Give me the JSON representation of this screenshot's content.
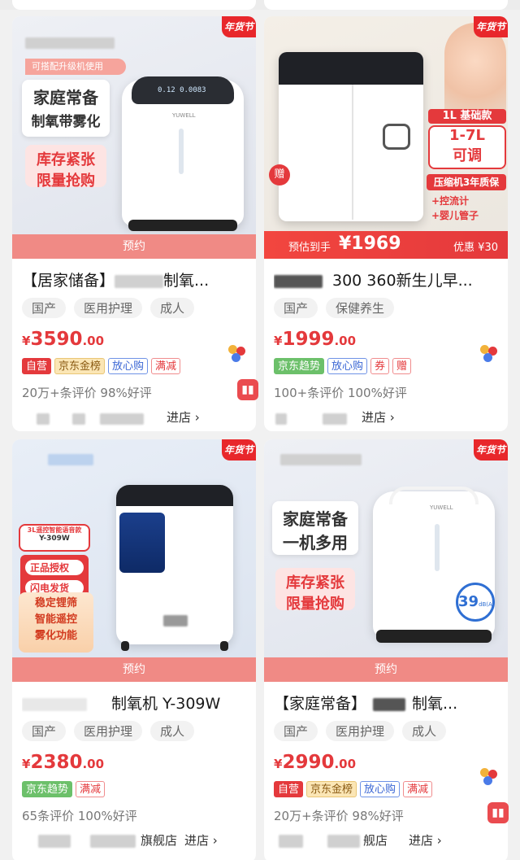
{
  "colors": {
    "accent_red": "#e4393c",
    "preorder_pink": "#f08a85",
    "tag_bg": "#f2f2f2"
  },
  "products": [
    {
      "corner_badge": "年货节",
      "image_text": {
        "top_banner": "可搭配升级机使用",
        "headline_1": "家庭常备",
        "headline_2": "制氧带雾化",
        "promo_1": "库存紧张",
        "promo_2": "限量抢购",
        "display": "0.12 0.0083",
        "brand_logo": "YUWELL"
      },
      "preorder": "预约",
      "title_prefix": "【居家储备】",
      "title_suffix": "制氧...",
      "tags": [
        "国产",
        "医用护理",
        "成人"
      ],
      "price_symbol": "¥",
      "price_int": "3590",
      "price_dec": ".00",
      "labels": [
        {
          "text": "自营",
          "style": "red"
        },
        {
          "text": "京东金榜",
          "style": "gold"
        },
        {
          "text": "放心购",
          "style": "blue"
        },
        {
          "text": "满减",
          "style": "redo"
        }
      ],
      "reviews": "20万+条评价  98%好评",
      "store_suffix": "进店 ›"
    },
    {
      "corner_badge": "年货节",
      "image_text": {
        "spec_1": "1L 基础款",
        "spec_2": "1-7L",
        "spec_3": "可调",
        "warranty": "压缩机3年质保",
        "extras_1": "+控流计",
        "extras_2": "+婴儿管子",
        "gift": "赠",
        "estimate_label": "预估到手",
        "estimate_price": "¥1969",
        "discount": "优惠 ¥30"
      },
      "title_suffix": "300 360新生儿早...",
      "tags": [
        "国产",
        "保健养生"
      ],
      "price_symbol": "¥",
      "price_int": "1999",
      "price_dec": ".00",
      "labels": [
        {
          "text": "京东趋势",
          "style": "green"
        },
        {
          "text": "放心购",
          "style": "blue"
        },
        {
          "text": "券",
          "style": "redo"
        },
        {
          "text": "赠",
          "style": "redo"
        }
      ],
      "reviews": "100+条评价  100%好评",
      "store_suffix": "进店 ›"
    },
    {
      "corner_badge": "年货节",
      "image_text": {
        "model_tag_1": "3L遥控智能语音款",
        "model_tag_2": "Y-309W",
        "cert_1": "正品授权",
        "cert_2": "闪电发货",
        "feature_1": "稳定锂筛",
        "feature_2": "智能遥控",
        "feature_3": "雾化功能"
      },
      "preorder": "预约",
      "title_suffix": "制氧机 Y-309W",
      "tags": [
        "国产",
        "医用护理",
        "成人"
      ],
      "price_symbol": "¥",
      "price_int": "2380",
      "price_dec": ".00",
      "labels": [
        {
          "text": "京东趋势",
          "style": "green"
        },
        {
          "text": "满减",
          "style": "redo"
        }
      ],
      "reviews": "65条评价  100%好评",
      "store_middle": "旗舰店",
      "store_suffix": "进店 ›"
    },
    {
      "corner_badge": "年货节",
      "image_text": {
        "headline_1": "家庭常备",
        "headline_2": "一机多用",
        "promo_1": "库存紧张",
        "promo_2": "限量抢购",
        "noise_value": "39",
        "noise_unit": "dB(A)",
        "brand_logo": "YUWELL"
      },
      "preorder": "预约",
      "title_prefix": "【家庭常备】",
      "title_suffix": "制氧...",
      "tags": [
        "国产",
        "医用护理",
        "成人"
      ],
      "price_symbol": "¥",
      "price_int": "2990",
      "price_dec": ".00",
      "labels": [
        {
          "text": "自营",
          "style": "red"
        },
        {
          "text": "京东金榜",
          "style": "gold"
        },
        {
          "text": "放心购",
          "style": "blue"
        },
        {
          "text": "满减",
          "style": "redo"
        }
      ],
      "reviews": "20万+条评价  98%好评",
      "store_middle": "舰店",
      "store_suffix": "进店 ›"
    }
  ]
}
